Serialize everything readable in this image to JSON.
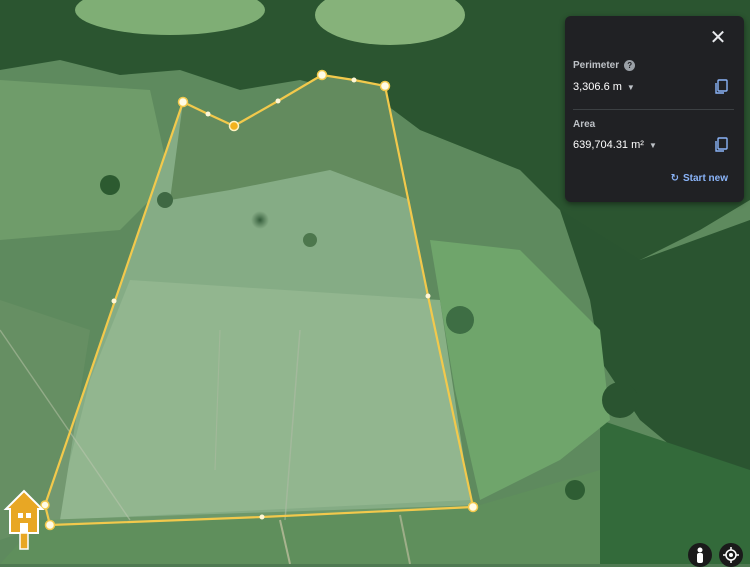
{
  "measure_panel": {
    "perimeter_label": "Perimeter",
    "perimeter_value": "3,306.6 m",
    "area_label": "Area",
    "area_value": "639,704.31 m²",
    "start_new_label": "Start new"
  },
  "colors": {
    "measure_line": "#f2c94c",
    "panel_bg": "#202124",
    "link": "#8ab4f8",
    "watermark": "#e8a724"
  },
  "icons": [
    "close-icon",
    "help-icon",
    "copy-icon",
    "refresh-icon",
    "pegman-icon",
    "my-location-icon",
    "house-watermark-icon"
  ]
}
